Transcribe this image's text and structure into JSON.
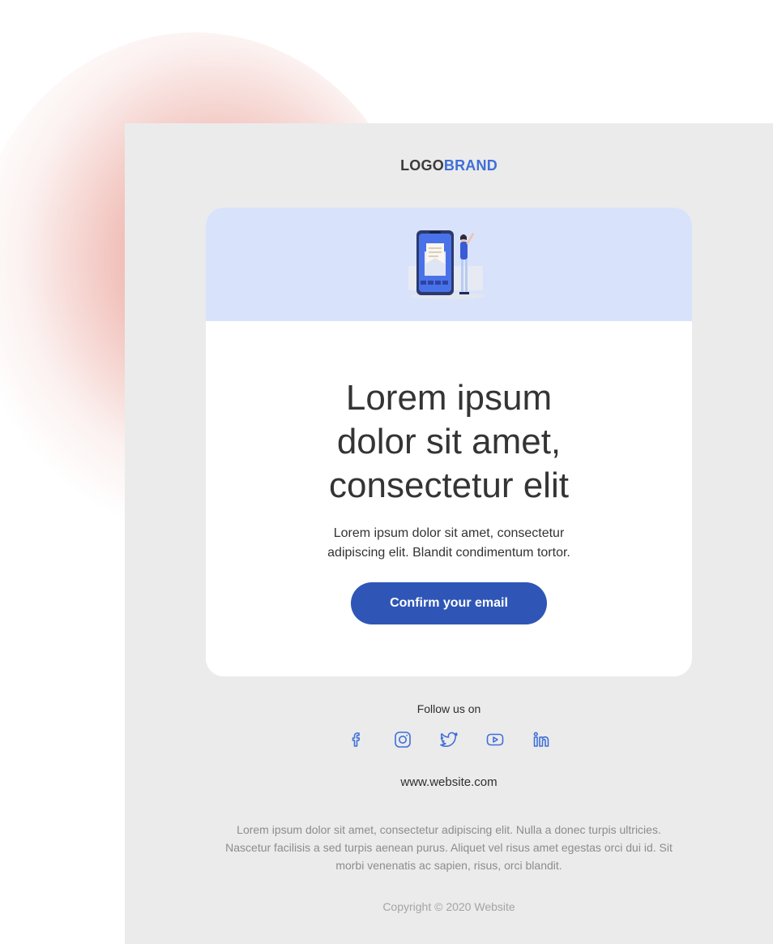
{
  "brand": {
    "part1": "LOGO",
    "part2": "BRAND",
    "part1_color": "#3b3b3b",
    "part2_color": "#3f6fd8"
  },
  "hero": {
    "background": "#d8e3fb",
    "illustration": "phone-email-person-illustration"
  },
  "card": {
    "headline": "Lorem ipsum dolor sit amet, consectetur elit",
    "body": "Lorem ipsum dolor sit amet, consectetur adipiscing elit. Blandit condimentum tortor.",
    "cta_label": "Confirm your email",
    "cta_color": "#2f56b6"
  },
  "footer": {
    "follow_label": "Follow us on",
    "social_icons": [
      "facebook-icon",
      "instagram-icon",
      "twitter-icon",
      "youtube-icon",
      "linkedin-icon"
    ],
    "icon_color": "#3f6fd8",
    "website": "www.website.com",
    "fine_print": "Lorem ipsum dolor sit amet, consectetur adipiscing elit. Nulla a donec turpis ultricies. Nascetur facilisis a sed turpis aenean purus. Aliquet vel risus amet egestas orci dui id. Sit morbi venenatis ac sapien, risus, orci blandit.",
    "copyright": "Copyright © 2020 Website"
  }
}
